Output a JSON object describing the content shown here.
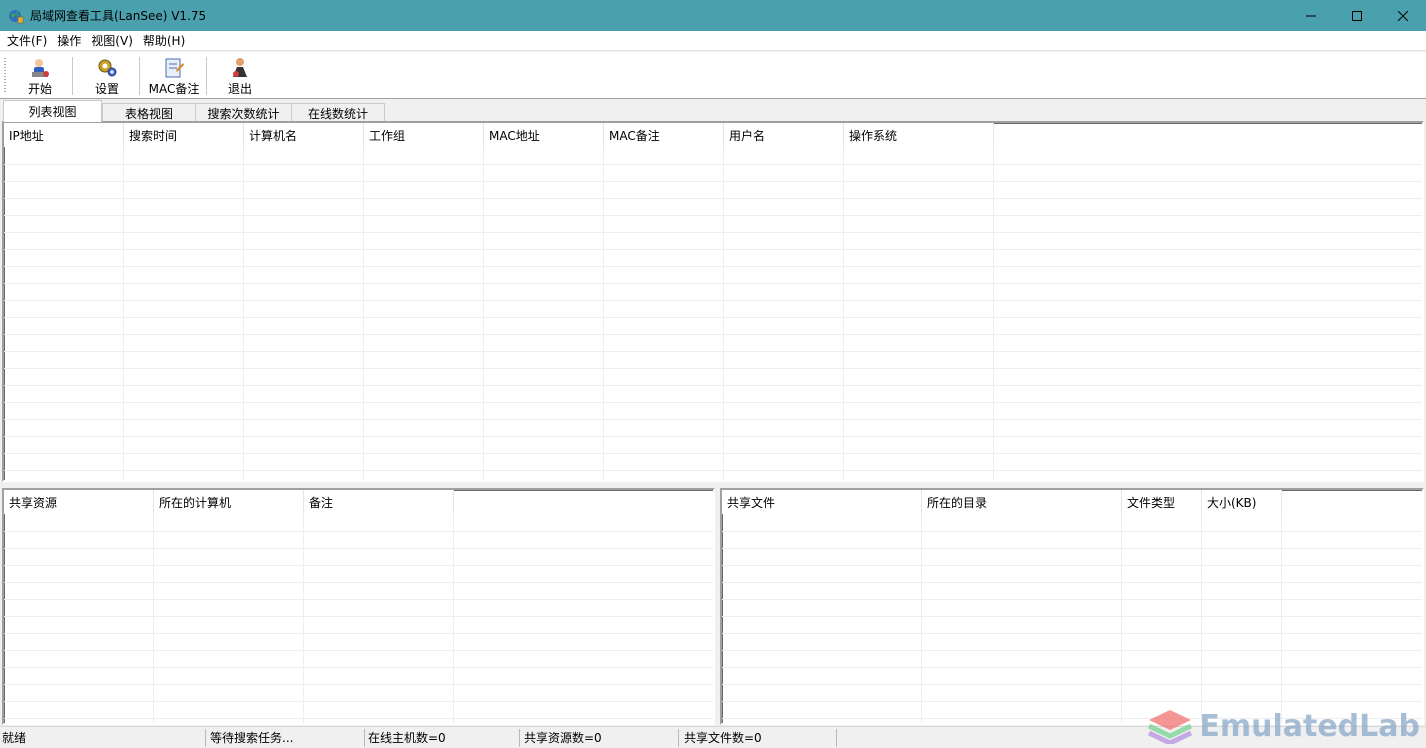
{
  "window": {
    "title": "局域网查看工具(LanSee) V1.75"
  },
  "menu": {
    "items": [
      "文件(F)",
      "操作",
      "视图(V)",
      "帮助(H)"
    ]
  },
  "toolbar": {
    "start_label": "开始",
    "settings_label": "设置",
    "mac_note_label": "MAC备注",
    "exit_label": "退出"
  },
  "tabs": [
    {
      "label": "列表视图",
      "active": true
    },
    {
      "label": "表格视图",
      "active": false
    },
    {
      "label": "搜索次数统计",
      "active": false
    },
    {
      "label": "在线数统计",
      "active": false
    }
  ],
  "hosts_table": {
    "columns": [
      "IP地址",
      "搜索时间",
      "计算机名",
      "工作组",
      "MAC地址",
      "MAC备注",
      "用户名",
      "操作系统"
    ],
    "rows": []
  },
  "shares_table": {
    "columns": [
      "共享资源",
      "所在的计算机",
      "备注"
    ],
    "rows": []
  },
  "files_table": {
    "columns": [
      "共享文件",
      "所在的目录",
      "文件类型",
      "大小(KB)"
    ],
    "rows": []
  },
  "status": {
    "ready": "就绪",
    "task": "等待搜索任务...",
    "online_hosts": "在线主机数=0",
    "share_count": "共享资源数=0",
    "file_count": "共享文件数=0"
  },
  "watermark": {
    "text": "EmulatedLab"
  },
  "colors": {
    "titlebar": "#4ba0ad",
    "window_bg": "#f0f0f0",
    "grid_line": "#eeeeee"
  }
}
